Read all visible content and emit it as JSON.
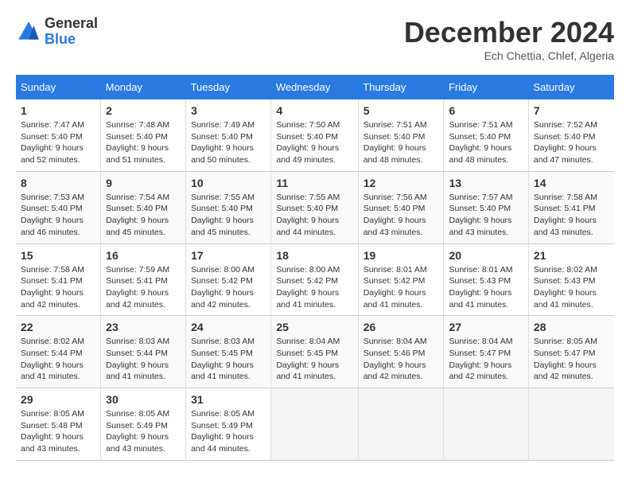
{
  "header": {
    "logo_general": "General",
    "logo_blue": "Blue",
    "month_title": "December 2024",
    "location": "Ech Chettia, Chlef, Algeria"
  },
  "columns": [
    "Sunday",
    "Monday",
    "Tuesday",
    "Wednesday",
    "Thursday",
    "Friday",
    "Saturday"
  ],
  "weeks": [
    [
      {
        "day": "1",
        "sunrise": "Sunrise: 7:47 AM",
        "sunset": "Sunset: 5:40 PM",
        "daylight": "Daylight: 9 hours and 52 minutes."
      },
      {
        "day": "2",
        "sunrise": "Sunrise: 7:48 AM",
        "sunset": "Sunset: 5:40 PM",
        "daylight": "Daylight: 9 hours and 51 minutes."
      },
      {
        "day": "3",
        "sunrise": "Sunrise: 7:49 AM",
        "sunset": "Sunset: 5:40 PM",
        "daylight": "Daylight: 9 hours and 50 minutes."
      },
      {
        "day": "4",
        "sunrise": "Sunrise: 7:50 AM",
        "sunset": "Sunset: 5:40 PM",
        "daylight": "Daylight: 9 hours and 49 minutes."
      },
      {
        "day": "5",
        "sunrise": "Sunrise: 7:51 AM",
        "sunset": "Sunset: 5:40 PM",
        "daylight": "Daylight: 9 hours and 48 minutes."
      },
      {
        "day": "6",
        "sunrise": "Sunrise: 7:51 AM",
        "sunset": "Sunset: 5:40 PM",
        "daylight": "Daylight: 9 hours and 48 minutes."
      },
      {
        "day": "7",
        "sunrise": "Sunrise: 7:52 AM",
        "sunset": "Sunset: 5:40 PM",
        "daylight": "Daylight: 9 hours and 47 minutes."
      }
    ],
    [
      {
        "day": "8",
        "sunrise": "Sunrise: 7:53 AM",
        "sunset": "Sunset: 5:40 PM",
        "daylight": "Daylight: 9 hours and 46 minutes."
      },
      {
        "day": "9",
        "sunrise": "Sunrise: 7:54 AM",
        "sunset": "Sunset: 5:40 PM",
        "daylight": "Daylight: 9 hours and 45 minutes."
      },
      {
        "day": "10",
        "sunrise": "Sunrise: 7:55 AM",
        "sunset": "Sunset: 5:40 PM",
        "daylight": "Daylight: 9 hours and 45 minutes."
      },
      {
        "day": "11",
        "sunrise": "Sunrise: 7:55 AM",
        "sunset": "Sunset: 5:40 PM",
        "daylight": "Daylight: 9 hours and 44 minutes."
      },
      {
        "day": "12",
        "sunrise": "Sunrise: 7:56 AM",
        "sunset": "Sunset: 5:40 PM",
        "daylight": "Daylight: 9 hours and 43 minutes."
      },
      {
        "day": "13",
        "sunrise": "Sunrise: 7:57 AM",
        "sunset": "Sunset: 5:40 PM",
        "daylight": "Daylight: 9 hours and 43 minutes."
      },
      {
        "day": "14",
        "sunrise": "Sunrise: 7:58 AM",
        "sunset": "Sunset: 5:41 PM",
        "daylight": "Daylight: 9 hours and 43 minutes."
      }
    ],
    [
      {
        "day": "15",
        "sunrise": "Sunrise: 7:58 AM",
        "sunset": "Sunset: 5:41 PM",
        "daylight": "Daylight: 9 hours and 42 minutes."
      },
      {
        "day": "16",
        "sunrise": "Sunrise: 7:59 AM",
        "sunset": "Sunset: 5:41 PM",
        "daylight": "Daylight: 9 hours and 42 minutes."
      },
      {
        "day": "17",
        "sunrise": "Sunrise: 8:00 AM",
        "sunset": "Sunset: 5:42 PM",
        "daylight": "Daylight: 9 hours and 42 minutes."
      },
      {
        "day": "18",
        "sunrise": "Sunrise: 8:00 AM",
        "sunset": "Sunset: 5:42 PM",
        "daylight": "Daylight: 9 hours and 41 minutes."
      },
      {
        "day": "19",
        "sunrise": "Sunrise: 8:01 AM",
        "sunset": "Sunset: 5:42 PM",
        "daylight": "Daylight: 9 hours and 41 minutes."
      },
      {
        "day": "20",
        "sunrise": "Sunrise: 8:01 AM",
        "sunset": "Sunset: 5:43 PM",
        "daylight": "Daylight: 9 hours and 41 minutes."
      },
      {
        "day": "21",
        "sunrise": "Sunrise: 8:02 AM",
        "sunset": "Sunset: 5:43 PM",
        "daylight": "Daylight: 9 hours and 41 minutes."
      }
    ],
    [
      {
        "day": "22",
        "sunrise": "Sunrise: 8:02 AM",
        "sunset": "Sunset: 5:44 PM",
        "daylight": "Daylight: 9 hours and 41 minutes."
      },
      {
        "day": "23",
        "sunrise": "Sunrise: 8:03 AM",
        "sunset": "Sunset: 5:44 PM",
        "daylight": "Daylight: 9 hours and 41 minutes."
      },
      {
        "day": "24",
        "sunrise": "Sunrise: 8:03 AM",
        "sunset": "Sunset: 5:45 PM",
        "daylight": "Daylight: 9 hours and 41 minutes."
      },
      {
        "day": "25",
        "sunrise": "Sunrise: 8:04 AM",
        "sunset": "Sunset: 5:45 PM",
        "daylight": "Daylight: 9 hours and 41 minutes."
      },
      {
        "day": "26",
        "sunrise": "Sunrise: 8:04 AM",
        "sunset": "Sunset: 5:46 PM",
        "daylight": "Daylight: 9 hours and 42 minutes."
      },
      {
        "day": "27",
        "sunrise": "Sunrise: 8:04 AM",
        "sunset": "Sunset: 5:47 PM",
        "daylight": "Daylight: 9 hours and 42 minutes."
      },
      {
        "day": "28",
        "sunrise": "Sunrise: 8:05 AM",
        "sunset": "Sunset: 5:47 PM",
        "daylight": "Daylight: 9 hours and 42 minutes."
      }
    ],
    [
      {
        "day": "29",
        "sunrise": "Sunrise: 8:05 AM",
        "sunset": "Sunset: 5:48 PM",
        "daylight": "Daylight: 9 hours and 43 minutes."
      },
      {
        "day": "30",
        "sunrise": "Sunrise: 8:05 AM",
        "sunset": "Sunset: 5:49 PM",
        "daylight": "Daylight: 9 hours and 43 minutes."
      },
      {
        "day": "31",
        "sunrise": "Sunrise: 8:05 AM",
        "sunset": "Sunset: 5:49 PM",
        "daylight": "Daylight: 9 hours and 44 minutes."
      },
      null,
      null,
      null,
      null
    ]
  ]
}
